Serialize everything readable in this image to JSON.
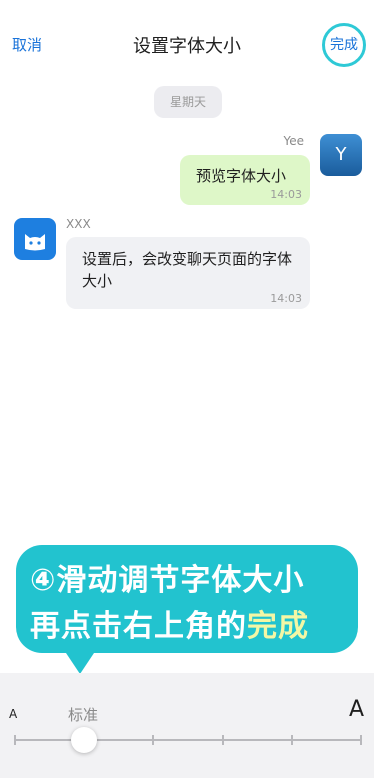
{
  "nav": {
    "cancel_label": "取消",
    "title": "设置字体大小",
    "done_label": "完成"
  },
  "chat": {
    "date_label": "星期天",
    "sent": {
      "sender": "Yee",
      "avatar_letter": "Y",
      "text": "预览字体大小",
      "time": "14:03"
    },
    "received": {
      "sender": "XXX",
      "text": "设置后，会改变聊天页面的字体大小",
      "time": "14:03"
    }
  },
  "tip": {
    "line1": "④滑动调节字体大小",
    "line2_prefix": "再点击右上角的",
    "line2_highlight": "完成",
    "colors": {
      "bubble": "#22c3cf",
      "highlight": "#f3f7a5"
    }
  },
  "font_size": {
    "small_label": "A",
    "large_label": "A",
    "current_label": "标准",
    "steps": 6,
    "current_step": 2
  },
  "colors": {
    "accent": "#1a73d9",
    "sent_bubble": "#def7c8",
    "received_bubble": "#f0f1f4"
  }
}
